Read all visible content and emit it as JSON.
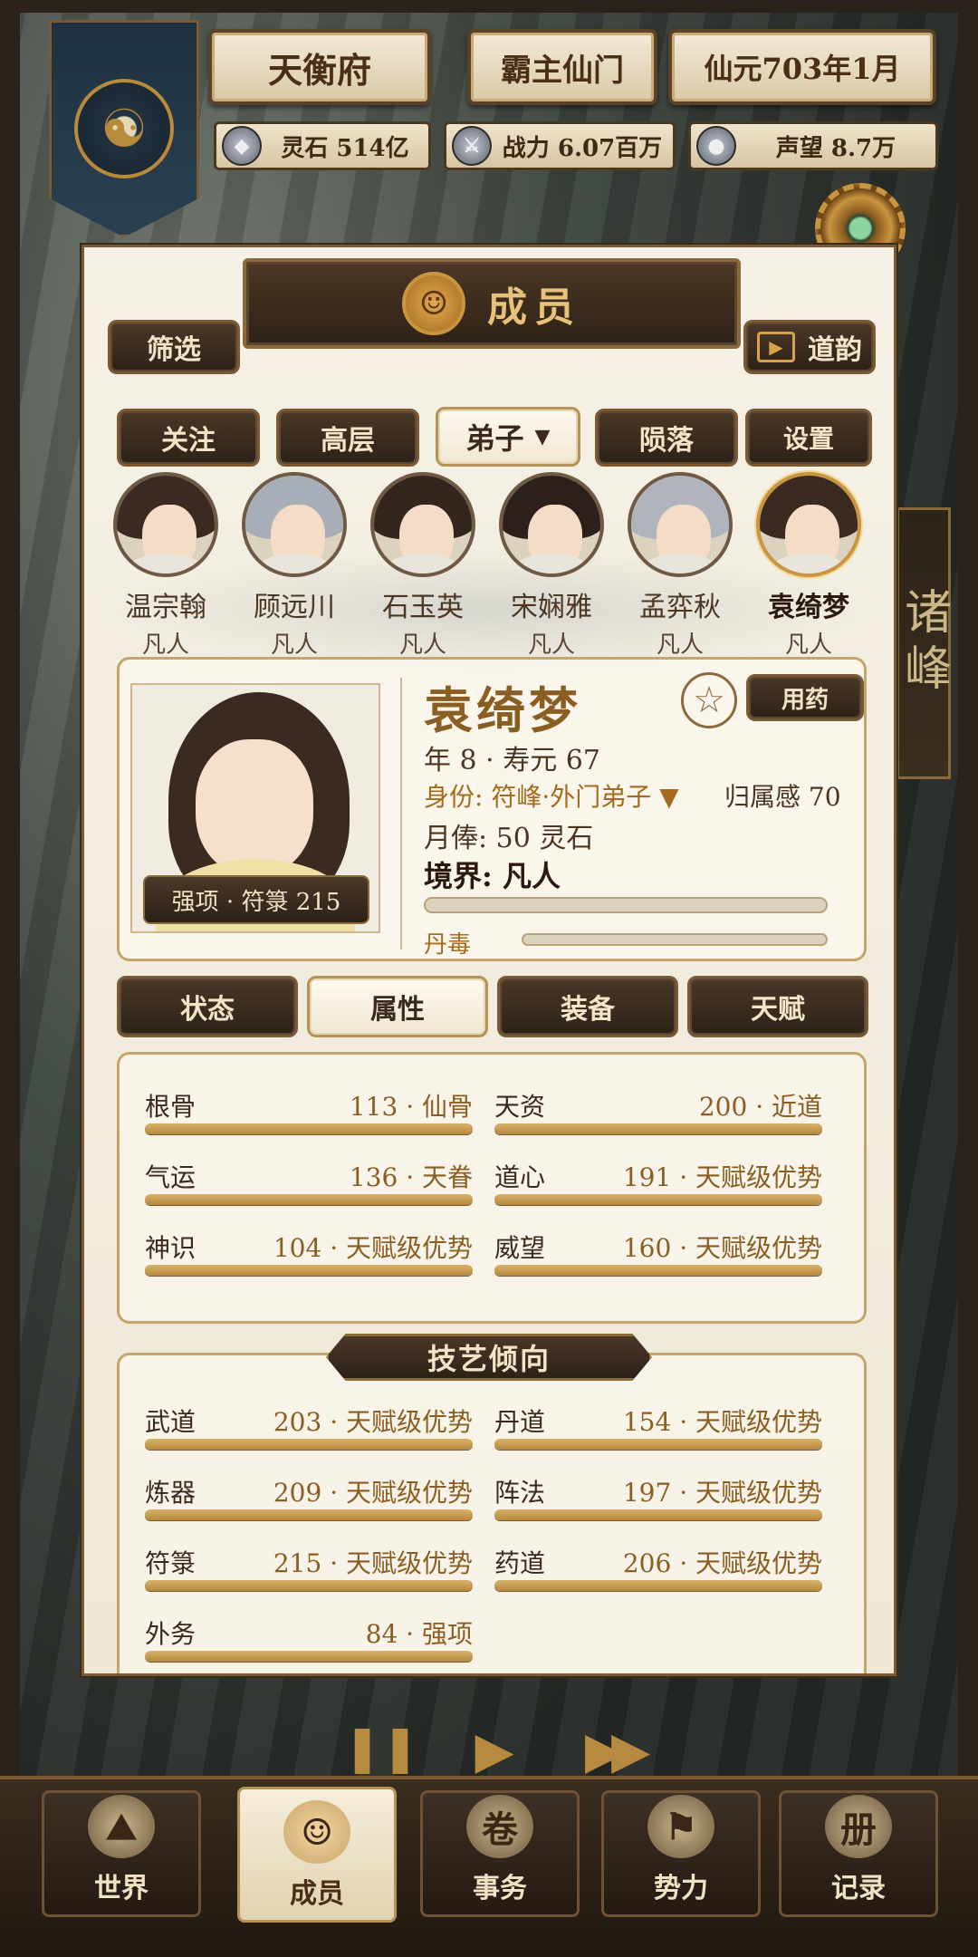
{
  "header": {
    "sect_name": "天衡府",
    "title": "霸主仙门",
    "date": "仙元703年1月",
    "resources": [
      {
        "icon": "spirit-stone-icon",
        "label": "灵石 514亿"
      },
      {
        "icon": "sword-icon",
        "label": "战力 6.07百万"
      },
      {
        "icon": "reputation-icon",
        "label": "声望 8.7万"
      }
    ]
  },
  "side_tag": "诸峰",
  "panel": {
    "title": "成员",
    "filter_label": "筛选",
    "daoyun_label": "道韵",
    "categories": [
      "关注",
      "高层",
      "弟子",
      "陨落",
      "设置"
    ],
    "members": [
      {
        "name": "温宗翰",
        "rank": "凡人",
        "hair": "#3a2a22"
      },
      {
        "name": "顾远川",
        "rank": "凡人",
        "hair": "#a8aeb8"
      },
      {
        "name": "石玉英",
        "rank": "凡人",
        "hair": "#34261e"
      },
      {
        "name": "宋娴雅",
        "rank": "凡人",
        "hair": "#2c201a"
      },
      {
        "name": "孟弈秋",
        "rank": "凡人",
        "hair": "#b0b4bc"
      },
      {
        "name": "袁绮梦",
        "rank": "凡人",
        "hair": "#3a2a20"
      }
    ],
    "selected": {
      "name": "袁绮梦",
      "strength_tag": "强项 · 符箓 215",
      "use_medicine": "用药",
      "age_line": "年 8 · 寿元 67",
      "identity": "身份: 符峰·外门弟子 ▼",
      "belonging": "归属感 70",
      "salary": "月俸: 50 灵石",
      "realm": "境界: 凡人",
      "pill_poison_label": "丹毒"
    },
    "tabs": [
      "状态",
      "属性",
      "装备",
      "天赋"
    ],
    "attributes": [
      {
        "name": "根骨",
        "value": "113 · 仙骨"
      },
      {
        "name": "天资",
        "value": "200 · 近道"
      },
      {
        "name": "气运",
        "value": "136 · 天眷"
      },
      {
        "name": "道心",
        "value": "191 · 天赋级优势"
      },
      {
        "name": "神识",
        "value": "104 · 天赋级优势"
      },
      {
        "name": "威望",
        "value": "160 · 天赋级优势"
      }
    ],
    "skills_title": "技艺倾向",
    "skills": [
      {
        "name": "武道",
        "value": "203 · 天赋级优势"
      },
      {
        "name": "丹道",
        "value": "154 · 天赋级优势"
      },
      {
        "name": "炼器",
        "value": "209 · 天赋级优势"
      },
      {
        "name": "阵法",
        "value": "197 · 天赋级优势"
      },
      {
        "name": "符箓",
        "value": "215 · 天赋级优势"
      },
      {
        "name": "药道",
        "value": "206 · 天赋级优势"
      },
      {
        "name": "外务",
        "value": "84 · 强项"
      }
    ]
  },
  "controls": {
    "pause": "❚❚",
    "play": "▶",
    "fast": "▶▶"
  },
  "nav": [
    {
      "label": "世界",
      "icon": "mountain-icon",
      "glyph": "⛰"
    },
    {
      "label": "成员",
      "icon": "member-icon",
      "glyph": "☺"
    },
    {
      "label": "事务",
      "icon": "scroll-icon",
      "glyph": "卷"
    },
    {
      "label": "势力",
      "icon": "flag-icon",
      "glyph": "⚑"
    },
    {
      "label": "记录",
      "icon": "book-icon",
      "glyph": "册"
    }
  ]
}
